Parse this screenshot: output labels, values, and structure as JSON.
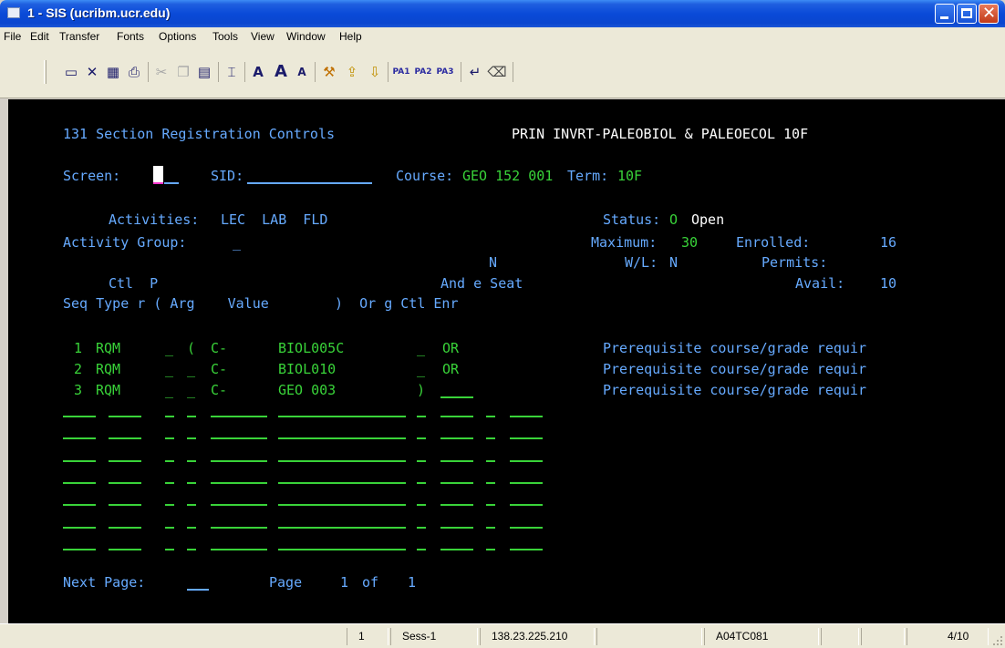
{
  "window": {
    "title": "1 - SIS (ucribm.ucr.edu)",
    "minimize": "minimize",
    "maximize": "maximize",
    "close": "close"
  },
  "menu": [
    "File",
    "Edit",
    "Transfer",
    "Fonts",
    "Options",
    "Tools",
    "View",
    "Window",
    "Help"
  ],
  "toolbar": {
    "icons": [
      "print-screen-icon",
      "cancel-icon",
      "copy-screen-icon",
      "print-icon",
      "cut-icon",
      "copy-icon",
      "paste-icon",
      "select-icon",
      "font-icon",
      "font-larger-icon",
      "font-smaller-icon",
      "tools-icon",
      "send-file-icon",
      "receive-file-icon"
    ],
    "pa_keys": [
      "PA1",
      "PA2",
      "PA3"
    ],
    "enter_icon": "enter-icon",
    "erase_icon": "erase-icon"
  },
  "terminal": {
    "screen_title": "131 Section Registration Controls",
    "course_title": "PRIN INVRT-PALEOBIOL & PALEOECOL 10F",
    "screen_label": "Screen:",
    "screen_value": "",
    "sid_label": "SID:",
    "sid_value": "",
    "course_label": "Course:",
    "course_value": "GEO 152 001",
    "term_label": "Term:",
    "term_value": "10F",
    "activities_label": "Activities:",
    "activities_value": "LEC  LAB  FLD",
    "status_label": "Status:",
    "status_code": "O",
    "status_text": "Open",
    "activity_group_label": "Activity Group:",
    "activity_group_value": "_",
    "maximum_label": "Maximum:",
    "maximum_value": "30",
    "enrolled_label": "Enrolled:",
    "enrolled_value": "16",
    "wl_label": "W/L:",
    "wl_value": "N",
    "permits_label": "Permits:",
    "permits_value": "",
    "avail_label": "Avail:",
    "avail_value": "10",
    "header_line1": "N",
    "header_line2_left": "Ctl  P",
    "header_line2_right": "And e Seat",
    "header_line3": "Seq Type r ( Arg    Value        )  Or g Ctl Enr",
    "rows": [
      {
        "seq": "1",
        "type": "RQM",
        "paren_flag": "_",
        "open_paren": "(",
        "arg": "C-",
        "value": "BIOL005C",
        "close": "_",
        "andor": "OR",
        "desc": "Prerequisite course/grade requir"
      },
      {
        "seq": "2",
        "type": "RQM",
        "paren_flag": "_",
        "open_paren": "_",
        "arg": "C-",
        "value": "BIOL010",
        "close": "_",
        "andor": "OR",
        "desc": "Prerequisite course/grade requir"
      },
      {
        "seq": "3",
        "type": "RQM",
        "paren_flag": "_",
        "open_paren": "_",
        "arg": "C-",
        "value": "GEO 003",
        "close": ")",
        "andor": "",
        "desc": "Prerequisite course/grade requir"
      }
    ],
    "next_page_label": "Next Page:",
    "page_label": "Page",
    "page_current": "1",
    "page_of": "of",
    "page_total": "1"
  },
  "statusbar": {
    "cells": [
      "1",
      "Sess-1",
      "138.23.225.210",
      "",
      "A04TC081",
      "",
      "",
      "4/10"
    ]
  }
}
